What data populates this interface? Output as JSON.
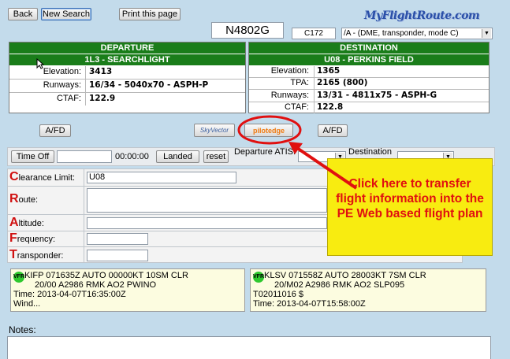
{
  "toolbar": {
    "back_label": "Back",
    "new_search_label": "New Search",
    "print_label": "Print this page"
  },
  "flight": {
    "tail_number": "N4802G",
    "aircraft_type": "C172",
    "equipment": "/A  - (DME, transponder, mode C)"
  },
  "logo": {
    "text": "MyFlightRoute.com"
  },
  "departure": {
    "header": "DEPARTURE",
    "airport": "1L3 - SEARCHLIGHT",
    "rows": [
      {
        "label": "Elevation:",
        "value": "3413"
      },
      {
        "label": "Runways:",
        "value": "16/34 - 5040x70 - ASPH-P"
      },
      {
        "label": "CTAF:",
        "value": "122.9"
      }
    ]
  },
  "destination": {
    "header": "DESTINATION",
    "airport": "U08 - PERKINS FIELD",
    "rows": [
      {
        "label": "Elevation:",
        "value": "1365"
      },
      {
        "label": "TPA:",
        "value": "2165 (800)"
      },
      {
        "label": "Runways:",
        "value": "13/31 - 4811x75 - ASPH-G"
      },
      {
        "label": "CTAF:",
        "value": "122.8"
      }
    ]
  },
  "links": {
    "afd_left": "A/FD",
    "skyvector": "SkyVector",
    "pilotedge": "pilotedge",
    "afd_right": "A/FD"
  },
  "timer": {
    "time_off_label": "Time Off",
    "elapsed": "00:00:00",
    "landed_label": "Landed",
    "reset_label": "reset",
    "departure_atis_label": "Departure ATIS:",
    "destination_label": "Destination"
  },
  "craft": {
    "clearance": {
      "letter": "C",
      "rest": "learance Limit:",
      "value": "U08"
    },
    "route": {
      "letter": "R",
      "rest": "oute:"
    },
    "altitude": {
      "letter": "A",
      "rest": "ltitude:"
    },
    "frequency": {
      "letter": "F",
      "rest": "requency:"
    },
    "transponder": {
      "letter": "T",
      "rest": "ransponder:"
    }
  },
  "metar_left": {
    "badge": "VFR",
    "line1": "KIFP 071635Z AUTO 00000KT 10SM CLR",
    "line2": "20/00 A2986 RMK AO2 PWINO",
    "line3": "Time: 2013-04-07T16:35:00Z",
    "line4": "Wind..."
  },
  "metar_right": {
    "badge": "VFR",
    "line1": "KLSV 071558Z AUTO 28003KT 7SM CLR",
    "line2": "20/M02 A2986 RMK AO2 SLP095",
    "line3": "T02011016 $",
    "line4": "Time: 2013-04-07T15:58:00Z"
  },
  "notes": {
    "label": "Notes:"
  },
  "callout": {
    "text": "Click here to transfer flight information into the PE Web based flight plan",
    "color": "#f8ec10",
    "text_color": "#e01010"
  }
}
